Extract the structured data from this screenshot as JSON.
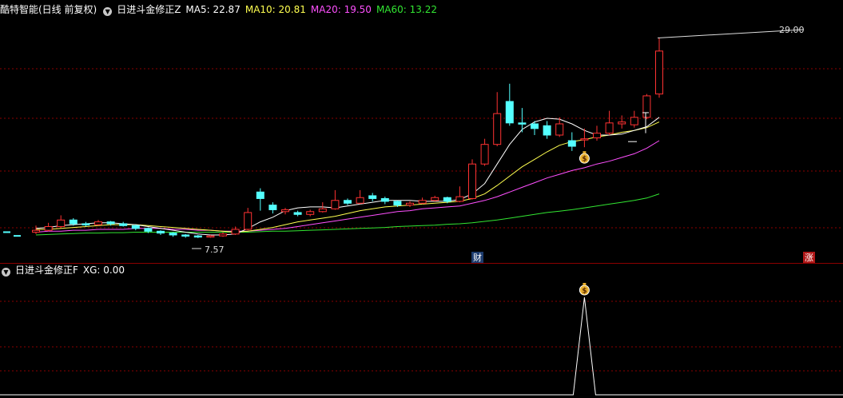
{
  "main_legend": {
    "stock": "酷特智能(日线 前复权)",
    "indicator": "日进斗金修正Z",
    "ma5": "MA5: 22.87",
    "ma10": "MA10: 20.81",
    "ma20": "MA20: 19.50",
    "ma60": "MA60: 13.22"
  },
  "sub_legend": {
    "indicator": "日进斗金修正F",
    "xg": "XG: 0.00"
  },
  "colors": {
    "up": "#ff3232",
    "down": "#54ffff",
    "ma5": "#ffffff",
    "ma10": "#ffff50",
    "ma20": "#ff50ff",
    "ma60": "#32e632",
    "grid": "#8b0000"
  },
  "icons": {
    "signal": "money-bag-icon",
    "collapse": "chevron-circle-icon"
  },
  "annotations": {
    "high": "29.00",
    "low": "7.57",
    "finance": "财",
    "limit_up": "涨"
  },
  "chart_data": {
    "type": "candlestick",
    "ylim": [
      6.7,
      30.5
    ],
    "candles": [
      [
        8.2,
        8.4,
        8.9,
        8.0
      ],
      [
        8.4,
        8.8,
        9.2,
        8.3
      ],
      [
        8.8,
        9.5,
        10.0,
        8.7
      ],
      [
        9.5,
        9.1,
        9.7,
        8.9
      ],
      [
        9.1,
        9.0,
        9.3,
        8.8
      ],
      [
        9.0,
        9.3,
        9.5,
        8.9
      ],
      [
        9.3,
        9.1,
        9.4,
        8.9
      ],
      [
        9.1,
        8.9,
        9.3,
        8.8
      ],
      [
        8.9,
        8.6,
        9.0,
        8.4
      ],
      [
        8.6,
        8.3,
        8.7,
        8.1
      ],
      [
        8.3,
        8.1,
        8.4,
        7.9
      ],
      [
        8.1,
        7.9,
        8.2,
        7.7
      ],
      [
        7.9,
        7.8,
        8.0,
        7.6
      ],
      [
        7.8,
        7.7,
        7.9,
        7.57
      ],
      [
        7.7,
        7.8,
        7.9,
        7.6
      ],
      [
        7.8,
        8.0,
        8.2,
        7.7
      ],
      [
        8.0,
        8.5,
        8.8,
        7.9
      ],
      [
        8.5,
        10.3,
        10.8,
        8.4
      ],
      [
        12.5,
        11.8,
        12.9,
        10.5
      ],
      [
        11.1,
        10.6,
        11.4,
        10.2
      ],
      [
        10.4,
        10.6,
        10.8,
        10.1
      ],
      [
        10.3,
        10.1,
        10.5,
        9.9
      ],
      [
        10.1,
        10.4,
        10.6,
        9.9
      ],
      [
        10.4,
        10.7,
        11.4,
        10.3
      ],
      [
        10.7,
        11.6,
        12.7,
        10.6
      ],
      [
        11.6,
        11.3,
        11.8,
        11.1
      ],
      [
        11.3,
        11.9,
        12.7,
        11.2
      ],
      [
        12.1,
        11.8,
        12.4,
        11.5
      ],
      [
        11.8,
        11.5,
        12.0,
        11.2
      ],
      [
        11.5,
        11.1,
        11.6,
        10.9
      ],
      [
        11.1,
        11.3,
        11.5,
        10.9
      ],
      [
        11.3,
        11.6,
        11.9,
        11.2
      ],
      [
        11.6,
        11.9,
        12.1,
        11.5
      ],
      [
        11.9,
        11.5,
        12.0,
        11.3
      ],
      [
        11.5,
        12.0,
        13.1,
        11.4
      ],
      [
        11.8,
        15.5,
        16.0,
        11.7
      ],
      [
        15.5,
        17.6,
        18.2,
        15.3
      ],
      [
        17.6,
        20.9,
        23.2,
        17.4
      ],
      [
        22.2,
        19.9,
        24.1,
        19.6
      ],
      [
        19.9,
        19.8,
        21.5,
        18.9
      ],
      [
        19.8,
        19.3,
        20.1,
        18.6
      ],
      [
        19.6,
        18.6,
        20.1,
        18.2
      ],
      [
        18.6,
        19.8,
        20.5,
        18.4
      ],
      [
        18.0,
        17.4,
        18.9,
        16.9
      ],
      [
        18.2,
        18.2,
        19.3,
        17.3
      ],
      [
        18.3,
        18.8,
        19.6,
        18.0
      ],
      [
        18.8,
        19.9,
        21.2,
        18.6
      ],
      [
        19.8,
        20.0,
        20.7,
        19.3
      ],
      [
        19.7,
        20.5,
        21.2,
        19.4
      ],
      [
        20.5,
        22.8,
        23.0,
        20.3
      ],
      [
        23.0,
        27.6,
        29.0,
        22.6
      ]
    ],
    "lead_flat": [
      8.2,
      7.8
    ],
    "tall_marker": [
      18.8,
      21.0
    ],
    "dash_marker": 17.9,
    "signal_index": 44,
    "ma5": [
      8.6,
      8.7,
      8.9,
      9.0,
      9.1,
      9.2,
      9.2,
      9.1,
      9.0,
      8.8,
      8.6,
      8.4,
      8.2,
      8.0,
      7.9,
      7.9,
      8.0,
      8.6,
      9.3,
      9.8,
      10.5,
      10.8,
      10.9,
      10.9,
      10.8,
      11.0,
      11.2,
      11.4,
      11.6,
      11.6,
      11.6,
      11.5,
      11.5,
      11.5,
      11.7,
      12.3,
      13.4,
      15.5,
      17.6,
      19.2,
      20.0,
      20.4,
      20.3,
      19.8,
      19.1,
      18.6,
      18.6,
      18.7,
      19.1,
      19.5,
      20.5
    ],
    "ma10": [
      8.5,
      8.5,
      8.6,
      8.7,
      8.8,
      8.9,
      9.0,
      9.0,
      9.0,
      8.9,
      8.8,
      8.7,
      8.6,
      8.5,
      8.4,
      8.3,
      8.2,
      8.3,
      8.5,
      8.7,
      9.0,
      9.3,
      9.5,
      9.7,
      9.9,
      10.2,
      10.5,
      10.7,
      10.9,
      11.0,
      11.1,
      11.2,
      11.3,
      11.4,
      11.5,
      11.8,
      12.3,
      13.2,
      14.2,
      15.2,
      16.0,
      16.8,
      17.5,
      17.9,
      18.1,
      18.4,
      18.6,
      18.9,
      19.1,
      19.4,
      20.0
    ],
    "ma20": [
      8.2,
      8.3,
      8.3,
      8.4,
      8.4,
      8.5,
      8.5,
      8.5,
      8.6,
      8.6,
      8.6,
      8.5,
      8.5,
      8.4,
      8.4,
      8.3,
      8.3,
      8.3,
      8.4,
      8.5,
      8.6,
      8.8,
      9.0,
      9.2,
      9.4,
      9.6,
      9.8,
      10.0,
      10.2,
      10.4,
      10.5,
      10.7,
      10.8,
      10.9,
      11.0,
      11.3,
      11.6,
      12.0,
      12.5,
      13.0,
      13.5,
      14.0,
      14.4,
      14.8,
      15.1,
      15.5,
      15.8,
      16.2,
      16.6,
      17.2,
      18.0
    ],
    "ma60": [
      7.9,
      7.95,
      8.0,
      8.05,
      8.1,
      8.1,
      8.15,
      8.15,
      8.2,
      8.2,
      8.2,
      8.2,
      8.2,
      8.2,
      8.2,
      8.2,
      8.2,
      8.2,
      8.25,
      8.3,
      8.3,
      8.35,
      8.4,
      8.45,
      8.5,
      8.55,
      8.6,
      8.65,
      8.7,
      8.8,
      8.85,
      8.9,
      8.95,
      9.05,
      9.1,
      9.2,
      9.35,
      9.5,
      9.7,
      9.9,
      10.1,
      10.3,
      10.45,
      10.6,
      10.8,
      11.0,
      11.2,
      11.4,
      11.6,
      11.85,
      12.3
    ]
  }
}
